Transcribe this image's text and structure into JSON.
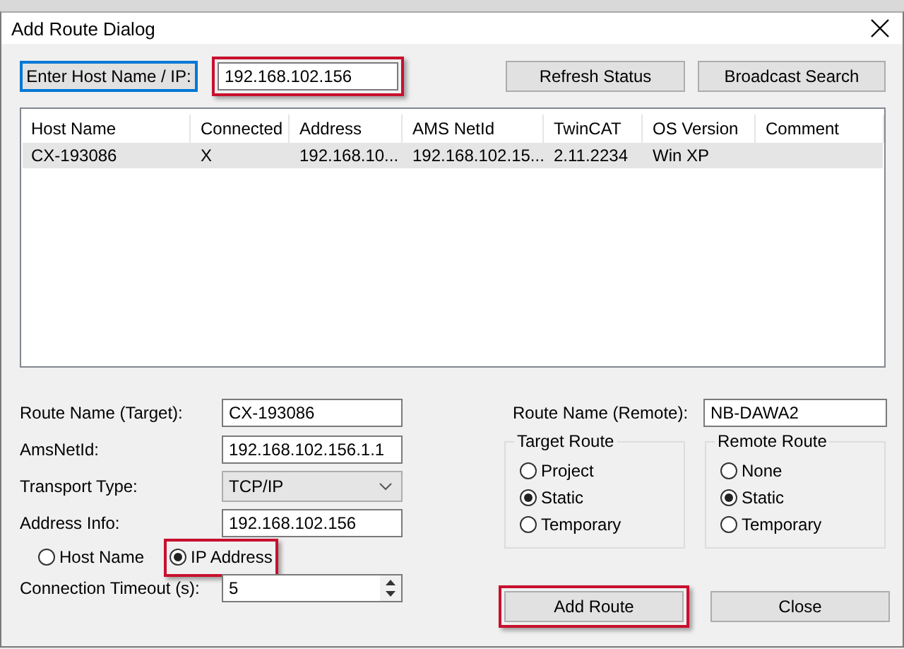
{
  "window": {
    "title": "Add Route Dialog"
  },
  "host_search": {
    "button": {
      "label": "Enter Host Name / IP:",
      "focused": true
    },
    "value": "192.168.102.156",
    "highlighted": true
  },
  "top_buttons": [
    {
      "label": "Refresh Status"
    },
    {
      "label": "Broadcast Search"
    }
  ],
  "table": {
    "columns": [
      "Host Name",
      "Connected",
      "Address",
      "AMS NetId",
      "TwinCAT",
      "OS Version",
      "Comment"
    ],
    "rows": [
      {
        "cells": [
          "CX-193086",
          "X",
          "192.168.10...",
          "192.168.102.15...",
          "2.11.2234",
          "Win XP",
          ""
        ],
        "selected": true
      }
    ]
  },
  "route_name_target": {
    "label": "Route Name (Target):",
    "value": "CX-193086"
  },
  "ams_net_id": {
    "label": "AmsNetId:",
    "value": "192.168.102.156.1.1"
  },
  "transport_type": {
    "label": "Transport Type:",
    "value": "TCP/IP"
  },
  "address_info": {
    "label": "Address Info:",
    "value": "192.168.102.156",
    "options": [
      {
        "label": "Host Name",
        "selected": false,
        "highlighted": false
      },
      {
        "label": "IP Address",
        "selected": true,
        "highlighted": true
      }
    ]
  },
  "connection_timeout": {
    "label": "Connection Timeout (s):",
    "value": "5"
  },
  "route_name_remote": {
    "label": "Route Name (Remote):",
    "value": "NB-DAWA2"
  },
  "target_route": {
    "title": "Target Route",
    "options": [
      {
        "label": "Project",
        "selected": false
      },
      {
        "label": "Static",
        "selected": true
      },
      {
        "label": "Temporary",
        "selected": false
      }
    ]
  },
  "remote_route": {
    "title": "Remote Route",
    "options": [
      {
        "label": "None",
        "selected": false
      },
      {
        "label": "Static",
        "selected": true
      },
      {
        "label": "Temporary",
        "selected": false
      }
    ]
  },
  "buttons": [
    {
      "label": "Add Route",
      "highlighted": true
    },
    {
      "label": "Close",
      "highlighted": false
    }
  ]
}
